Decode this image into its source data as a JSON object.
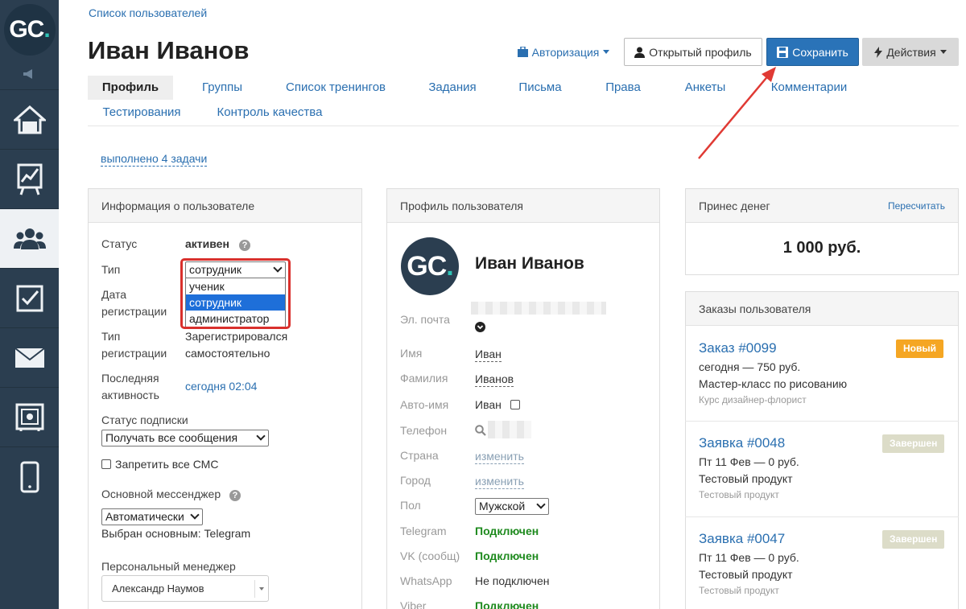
{
  "sidebar": {
    "logo_text": "GC",
    "logo_dot": ".",
    "items": [
      {
        "icon": "home-icon"
      },
      {
        "icon": "chart-board-icon"
      },
      {
        "icon": "users-icon",
        "active": true
      },
      {
        "icon": "checkbox-icon"
      },
      {
        "icon": "mail-icon"
      },
      {
        "icon": "safe-icon"
      },
      {
        "icon": "phone-icon"
      }
    ]
  },
  "header": {
    "breadcrumb": "Список пользователей",
    "title": "Иван Иванов",
    "auth_label": "Авторизация",
    "open_profile_label": "Открытый профиль",
    "save_label": "Сохранить",
    "actions_label": "Действия"
  },
  "tabs": [
    "Профиль",
    "Группы",
    "Список тренингов",
    "Задания",
    "Письма",
    "Права",
    "Анкеты",
    "Комментарии",
    "Тестирования",
    "Контроль качества"
  ],
  "tasks_link": "выполнено 4 задачи",
  "user_info": {
    "heading": "Информация о пользователе",
    "status_label": "Статус",
    "status_value": "активен",
    "type_label": "Тип",
    "type_selected": "сотрудник",
    "type_options": [
      "ученик",
      "сотрудник",
      "администратор"
    ],
    "reg_date_label_1": "Дата",
    "reg_date_label_2": "регистрации",
    "reg_type_label_1": "Тип",
    "reg_type_label_2": "регистрации",
    "reg_type_value_1": "Зарегистрировался",
    "reg_type_value_2": "самостоятельно",
    "last_activity_label_1": "Последняя",
    "last_activity_label_2": "активность",
    "last_activity_value": "сегодня 02:04",
    "subscription_label": "Статус подписки",
    "subscription_value": "Получать все сообщения",
    "block_sms_label": "Запретить все СМС",
    "messenger_label": "Основной мессенджер",
    "messenger_value": "Автоматически",
    "messenger_selected_text": "Выбран основным: Telegram",
    "manager_label": "Персональный менеджер",
    "manager_value": "Александр Наумов"
  },
  "profile": {
    "heading": "Профиль пользователя",
    "avatar_text": "GC",
    "avatar_dot": ".",
    "name": "Иван Иванов",
    "email_label": "Эл. почта",
    "first_name_label": "Имя",
    "first_name_value": "Иван",
    "last_name_label": "Фамилия",
    "last_name_value": "Иванов",
    "auto_name_label": "Авто-имя",
    "auto_name_value": "Иван",
    "phone_label": "Телефон",
    "country_label": "Страна",
    "country_value": "изменить",
    "city_label": "Город",
    "city_value": "изменить",
    "gender_label": "Пол",
    "gender_value": "Мужской",
    "telegram_label": "Telegram",
    "telegram_value": "Подключен",
    "vk_label": "VK (сообщ)",
    "vk_value": "Подключен",
    "whatsapp_label": "WhatsApp",
    "whatsapp_value": "Не подключен",
    "viber_label": "Viber",
    "viber_value": "Подключен"
  },
  "money": {
    "heading": "Принес денег",
    "recalc_label": "Пересчитать",
    "value": "1 000 руб."
  },
  "orders": {
    "heading": "Заказы пользователя",
    "items": [
      {
        "title": "Заказ #0099",
        "badge": "Новый",
        "line1": "сегодня — 750 руб.",
        "line2": "Мастер-класс по рисованию",
        "line3": "Курс дизайнер-флорист"
      },
      {
        "title": "Заявка #0048",
        "badge": "Завершен",
        "line1": "Пт 11 Фев — 0 руб.",
        "line2": "Тестовый продукт",
        "line3": "Тестовый продукт"
      },
      {
        "title": "Заявка #0047",
        "badge": "Завершен",
        "line1": "Пт 11 Фев — 0 руб.",
        "line2": "Тестовый продукт",
        "line3": "Тестовый продукт"
      }
    ]
  }
}
